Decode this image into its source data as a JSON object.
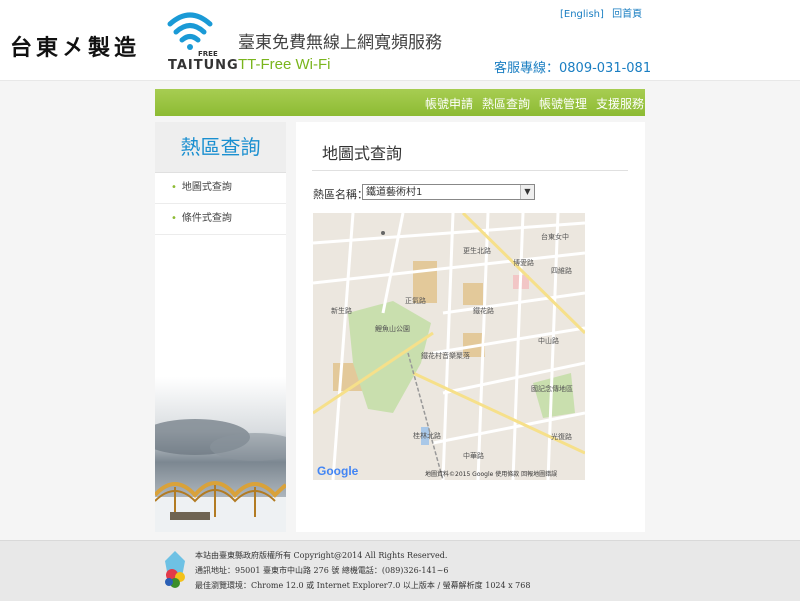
{
  "header": {
    "brand_chars": [
      "台",
      "東",
      "㐅",
      "製",
      "造"
    ],
    "logo_free": "FREE",
    "logo_text": "TAITUNG",
    "site_title": "臺東免費無線上網寬頻服務",
    "site_subtitle": "TT-Free Wi-Fi",
    "link_english": "[English]",
    "link_home": "回首頁",
    "hotline": "客服專線：0809-031-081"
  },
  "nav": {
    "items": [
      "帳號申請",
      "熱區查詢",
      "帳號管理",
      "支援服務"
    ]
  },
  "sidebar": {
    "title": "熱區查詢",
    "items": [
      "地圖式查詢",
      "條件式查詢"
    ]
  },
  "main": {
    "title": "地圖式查詢",
    "field_label": "熱區名稱：",
    "selected_hotspot": "鐵道藝術村1"
  },
  "map": {
    "labels": {
      "park": "鯉魚山公園",
      "station": "鐵花村音樂聚落",
      "school": "台東女中",
      "memorial": "國記念傳地區",
      "road1": "中華路",
      "road2": "新生路",
      "road3": "光復路",
      "road4": "博愛路",
      "road5": "桂林北路",
      "road6": "正氣路",
      "road7": "中山路",
      "road8": "四維路",
      "road9": "更生北路",
      "road10": "鐵花路"
    },
    "google": "Google",
    "attribution": "地圖資料©2015 Google   使用條款   回報地圖錯誤"
  },
  "footer": {
    "line1": "本站由臺東縣政府版權所有 Copyright@2014 All Rights Reserved.",
    "line2": "通訊地址：95001 臺東市中山路 276 號 總機電話：(089)326-141~6",
    "line3": "最佳瀏覽環境：Chrome 12.0 或 Internet Explorer7.0 以上版本 / 螢幕解析度 1024 x 768"
  },
  "colors": {
    "accent_green": "#8dbb33",
    "accent_blue": "#1a8fd0"
  }
}
